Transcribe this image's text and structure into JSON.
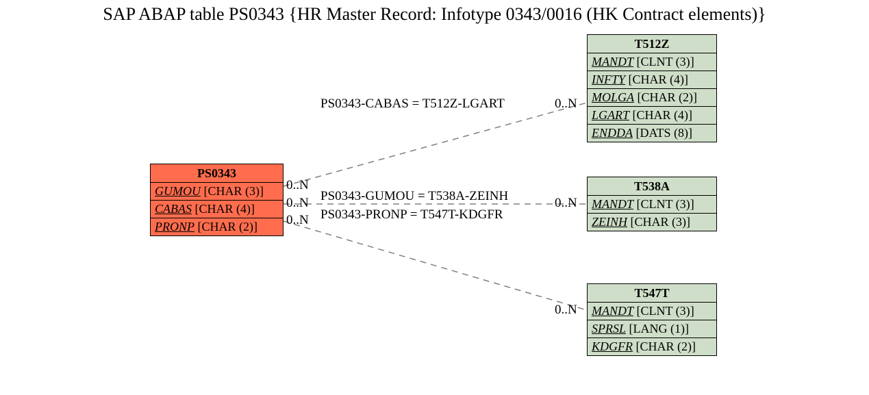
{
  "title": "SAP ABAP table PS0343 {HR Master Record: Infotype 0343/0016 (HK Contract elements)}",
  "source_table": {
    "name": "PS0343",
    "fields": [
      {
        "name": "GUMOU",
        "type": "CHAR (3)"
      },
      {
        "name": "CABAS",
        "type": "CHAR (4)"
      },
      {
        "name": "PRONP",
        "type": "CHAR (2)"
      }
    ]
  },
  "target_tables": [
    {
      "name": "T512Z",
      "fields": [
        {
          "name": "MANDT",
          "type": "CLNT (3)"
        },
        {
          "name": "INFTY",
          "type": "CHAR (4)"
        },
        {
          "name": "MOLGA",
          "type": "CHAR (2)"
        },
        {
          "name": "LGART",
          "type": "CHAR (4)"
        },
        {
          "name": "ENDDA",
          "type": "DATS (8)"
        }
      ]
    },
    {
      "name": "T538A",
      "fields": [
        {
          "name": "MANDT",
          "type": "CLNT (3)"
        },
        {
          "name": "ZEINH",
          "type": "CHAR (3)"
        }
      ]
    },
    {
      "name": "T547T",
      "fields": [
        {
          "name": "MANDT",
          "type": "CLNT (3)"
        },
        {
          "name": "SPRSL",
          "type": "LANG (1)"
        },
        {
          "name": "KDGFR",
          "type": "CHAR (2)"
        }
      ]
    }
  ],
  "relations": [
    {
      "text": "PS0343-CABAS = T512Z-LGART",
      "left_card": "0..N",
      "right_card": "0..N"
    },
    {
      "text": "PS0343-GUMOU = T538A-ZEINH",
      "left_card": "0..N",
      "right_card": "0..N"
    },
    {
      "text": "PS0343-PRONP = T547T-KDGFR",
      "left_card": "0..N",
      "right_card": "0..N"
    }
  ]
}
